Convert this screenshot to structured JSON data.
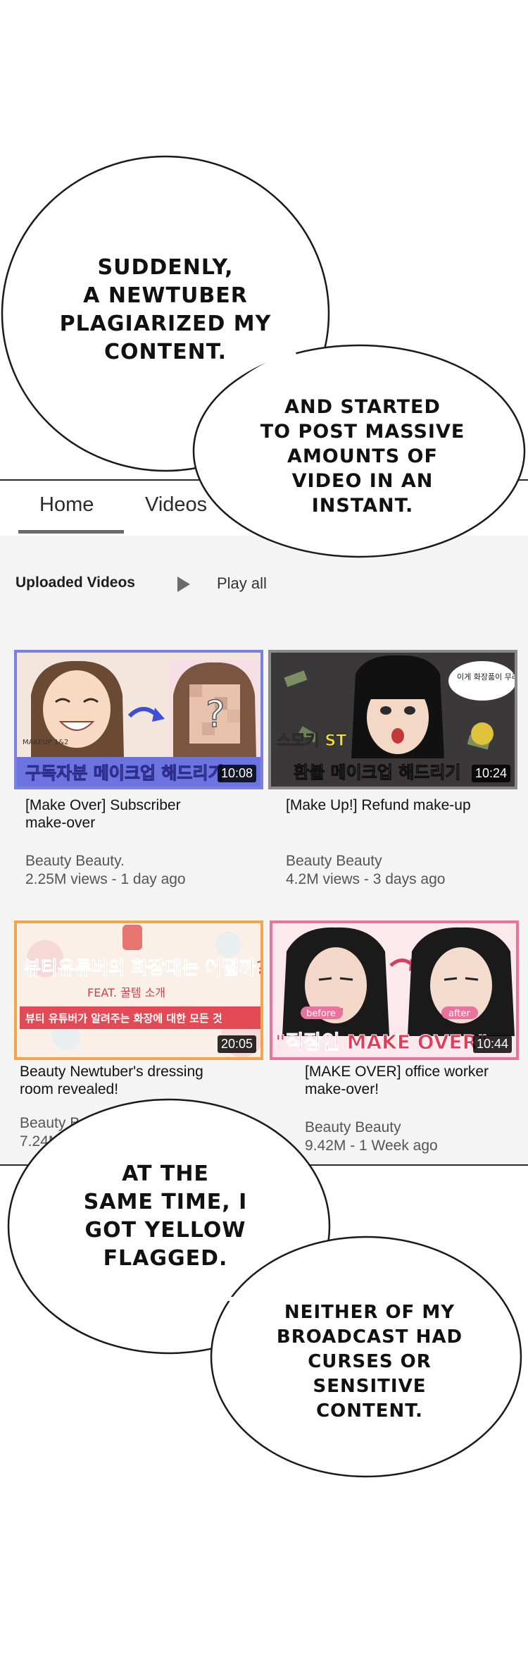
{
  "top_bubble": {
    "line1": "SUDDENLY,",
    "line2": "A NEWTUBER",
    "line3": "PLAGIARIZED MY",
    "line4": "CONTENT.",
    "right_line1": "AND STARTED",
    "right_line2": "TO POST MASSIVE",
    "right_line3": "AMOUNTS OF",
    "right_line4": "VIDEO IN AN",
    "right_line5": "INSTANT."
  },
  "tabs": {
    "home": "Home",
    "videos": "Videos"
  },
  "section": {
    "title": "Uploaded Videos",
    "play_all": "Play all"
  },
  "videos": [
    {
      "thumb_text": "구독자분 메이크업 해드리기",
      "thumb_small": "MAKEUP 1&2",
      "duration": "10:08",
      "title_line1": "[Make Over] Subscriber",
      "title_line2": "make-over",
      "channel": "Beauty Beauty.",
      "stats": "2.25M views - 1 day ago"
    },
    {
      "thumb_text": "환불 메이크업 해드리기",
      "thumb_small": "스모키 ST",
      "thumb_bubble": "이게 화장품이 무려 4만원!",
      "duration": "10:24",
      "title_line1": "[Make Up!] Refund make-up",
      "title_line2": "",
      "channel": "Beauty Beauty",
      "stats": "4.2M views - 3 days ago"
    },
    {
      "thumb_text": "뷰티유튜버의 화장대는 어떨까?",
      "thumb_small": "FEAT. 꿀템 소개",
      "thumb_sub": "뷰티 유튜버가 알려주는 화장에 대한 모든 것",
      "duration": "20:05",
      "title_line1": "Beauty Newtuber's dressing",
      "title_line2": "room revealed!",
      "channel": "Beauty Beauty",
      "stats": "7.24M - 5 days"
    },
    {
      "thumb_text": "\"직장인 MAKE OVER\"",
      "thumb_before": "before",
      "thumb_after": "after",
      "duration": "10:44",
      "title_line1": "[MAKE OVER] office worker",
      "title_line2": "make-over!",
      "channel": "Beauty Beauty",
      "stats": "9.42M - 1 Week ago"
    }
  ],
  "bottom_bubble": {
    "line1": "AT THE",
    "line2": "SAME TIME, I",
    "line3": "GOT YELLOW",
    "line4": "FLAGGED.",
    "right_line1": "NEITHER OF MY",
    "right_line2": "BROADCAST HAD",
    "right_line3": "CURSES OR",
    "right_line4": "SENSITIVE",
    "right_line5": "CONTENT."
  },
  "colors": {
    "thumb1_border": "#7b7fe0",
    "thumb3_border": "#f2a54a",
    "thumb4_border": "#e8739c"
  }
}
